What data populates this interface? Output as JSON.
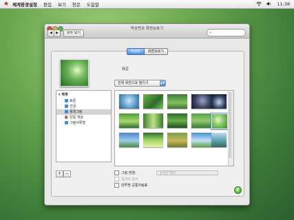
{
  "menubar": {
    "app": "체계환경설정",
    "items": [
      "편집",
      "보기",
      "창문",
      "도움말"
    ],
    "clock": "11:38"
  },
  "window": {
    "title": "탁상면과 화면보호기",
    "show_all": "모두 보기",
    "search_placeholder": ""
  },
  "tabs": [
    "탁상면",
    "화면보호기"
  ],
  "preview": {
    "name": "표준"
  },
  "fit_select": {
    "value": "전체 화면으로 펼치기"
  },
  "sources": {
    "header": "체계",
    "items": [
      {
        "label": "표준",
        "icon_color": "#4a8bd8",
        "selected": false
      },
      {
        "label": "선궁",
        "icon_color": "#4a8bd8",
        "selected": false
      },
      {
        "label": "풍경그림",
        "icon_color": "#4a8bd8",
        "selected": true
      },
      {
        "label": "단일 색상",
        "icon_color": "#c73a8c",
        "selected": false
      },
      {
        "label": "그림서류철",
        "icon_color": "#4a8bd8",
        "selected": false
      }
    ]
  },
  "options": {
    "change_picture": "그림 변경:",
    "interval": "1시간 마다",
    "random_order": "임의의 순서",
    "translucent_menubar": "반투명 공통차림표"
  },
  "colors": {
    "accent": "#4f8fd9",
    "desktop_green": "#4f8f44"
  }
}
